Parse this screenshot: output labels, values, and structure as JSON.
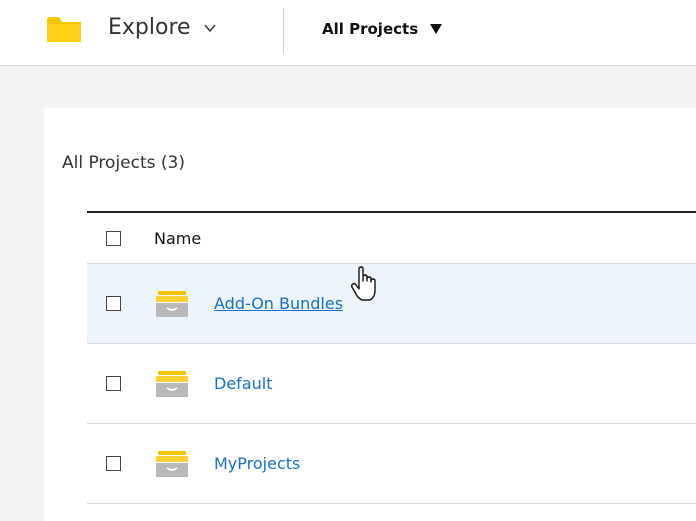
{
  "topbar": {
    "icons": {
      "folder": "folder-icon",
      "explore_chevron": "chevron-down-icon",
      "scope_caret": "caret-down-icon"
    },
    "explore_label": "Explore",
    "scope_label": "All Projects",
    "folder_color": "#f5c400"
  },
  "panel": {
    "title": "All Projects (3)",
    "table": {
      "column_name": "Name",
      "rows": [
        {
          "name": "Add-On Bundles",
          "hovered": true
        },
        {
          "name": "Default",
          "hovered": false
        },
        {
          "name": "MyProjects",
          "hovered": false
        }
      ]
    }
  },
  "colors": {
    "link": "#1a6fc8",
    "hover_row": "#eef4fb",
    "page_bg": "#f3f3f3"
  },
  "cursor": {
    "icon": "hand-pointer-cursor"
  }
}
